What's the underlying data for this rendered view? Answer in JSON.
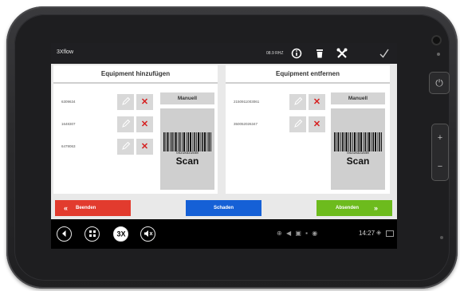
{
  "app": {
    "title": "3Xflow",
    "version": "08.9 RHZ"
  },
  "toolbar": {
    "icons": [
      "info-icon",
      "trash-icon",
      "tools-icon",
      "checkmark-icon"
    ]
  },
  "panels": {
    "add": {
      "title": "Equipment hinzufügen",
      "items": [
        "6309634",
        "1648307",
        "6479063"
      ],
      "manual_label": "Manuell",
      "barcode_number": "04218321548",
      "scan_label": "Scan"
    },
    "remove": {
      "title": "Equipment entfernen",
      "items": [
        "2150911003061",
        "350052026347"
      ],
      "manual_label": "Manuell",
      "barcode_number": "04218321548",
      "scan_label": "Scan"
    }
  },
  "actions": {
    "finish": {
      "label": "Beenden",
      "icon": "double-chevron-left-icon",
      "color": "#e23b2e"
    },
    "damage": {
      "label": "Schaden",
      "color": "#1560d6"
    },
    "submit": {
      "label": "Absenden",
      "icon": "double-chevron-right-icon",
      "color": "#6dbb1d"
    }
  },
  "system": {
    "nav_icons": [
      "back-icon",
      "apps-icon",
      "3x-logo-icon",
      "mute-icon"
    ],
    "clock": "14:27"
  },
  "device": {
    "buttons": [
      "power-button",
      "volume-up-button",
      "volume-down-button"
    ]
  }
}
